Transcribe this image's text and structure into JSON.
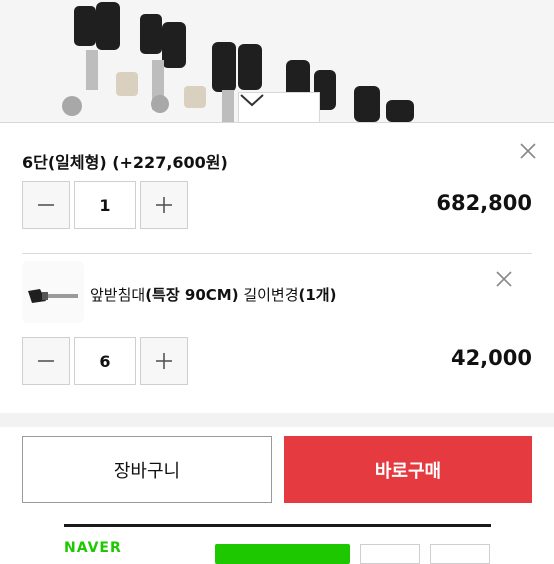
{
  "option1": {
    "title": "6단(일체형) (+227,600원)",
    "quantity": "1",
    "price": "682,800"
  },
  "option2": {
    "title_prefix": "앞받침대",
    "title_bold": "(특장 90CM)",
    "title_suffix": " 길이변경",
    "title_count": "(1개)",
    "quantity": "6",
    "price": "42,000"
  },
  "actions": {
    "cart_label": "장바구니",
    "buy_label": "바로구매"
  },
  "footer": {
    "brand": "NAVER"
  },
  "colors": {
    "buy_button": "#e53a40",
    "naver_green": "#1ec800"
  },
  "icons": [
    "chevron-down-icon",
    "close-icon",
    "minus-icon",
    "plus-icon"
  ]
}
